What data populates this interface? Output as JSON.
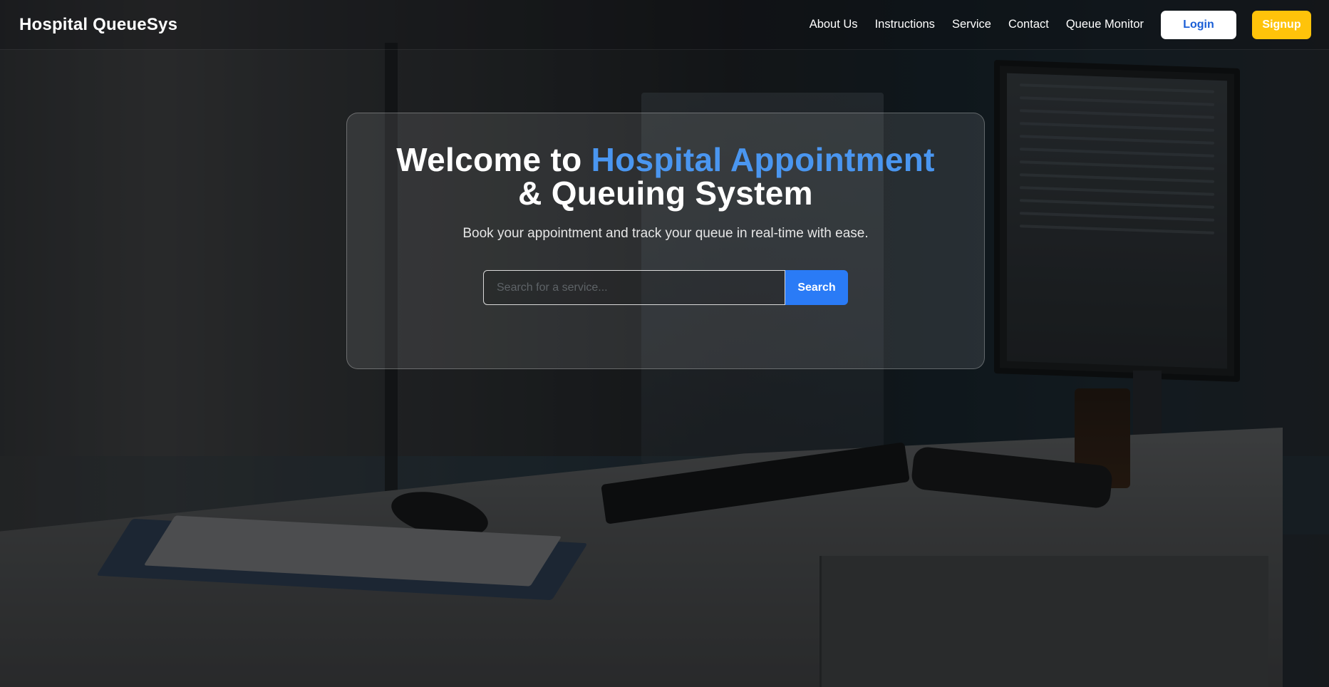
{
  "navbar": {
    "brand": "Hospital QueueSys",
    "links": [
      {
        "label": "About Us"
      },
      {
        "label": "Instructions"
      },
      {
        "label": "Service"
      },
      {
        "label": "Contact"
      },
      {
        "label": "Queue Monitor"
      }
    ],
    "login_label": "Login",
    "signup_label": "Signup"
  },
  "hero": {
    "title_prefix": "Welcome to ",
    "title_accent": "Hospital Appointment",
    "title_suffix": "& Queuing System",
    "subtitle": "Book your appointment and track your queue in real-time with ease.",
    "search": {
      "placeholder": "Search for a service...",
      "value": "",
      "button_label": "Search"
    }
  },
  "colors": {
    "accent": "#4a96f0",
    "login_text": "#1a5ed6",
    "signup_bg": "#ffc30a",
    "search_button": "#2a7bf6"
  }
}
